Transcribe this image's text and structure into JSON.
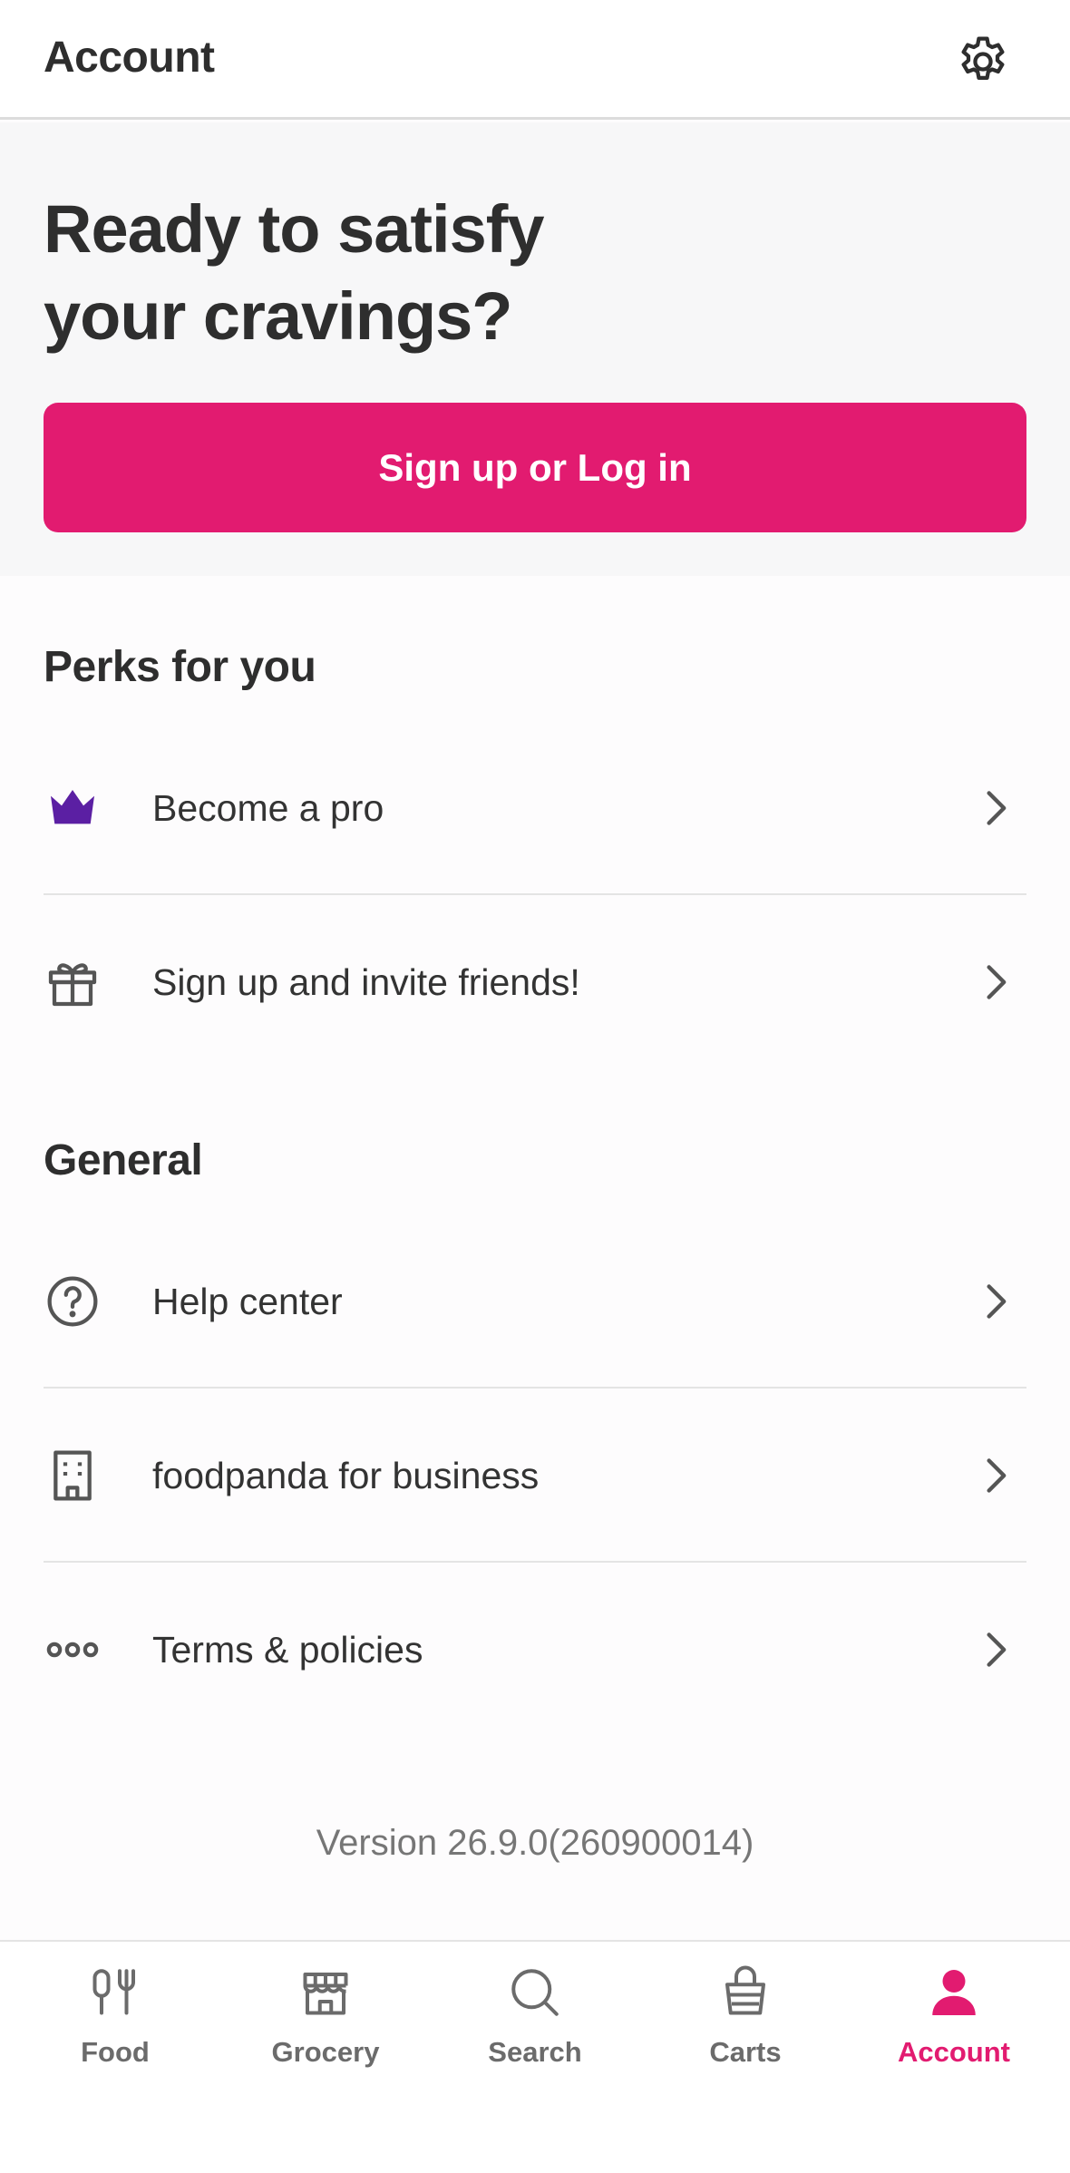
{
  "header": {
    "title": "Account",
    "settings_icon": "gear-icon"
  },
  "hero": {
    "title_line1": "Ready to satisfy",
    "title_line2": "your cravings?",
    "cta_label": "Sign up or Log in"
  },
  "perks": {
    "title": "Perks for you",
    "items": [
      {
        "label": "Become a pro",
        "icon": "crown-icon"
      },
      {
        "label": "Sign up and invite friends!",
        "icon": "gift-icon"
      }
    ]
  },
  "general": {
    "title": "General",
    "items": [
      {
        "label": "Help center",
        "icon": "question-circle-icon"
      },
      {
        "label": "foodpanda for business",
        "icon": "building-icon"
      },
      {
        "label": "Terms & policies",
        "icon": "more-dots-icon"
      }
    ]
  },
  "version": "Version 26.9.0(260900014)",
  "bottom_nav": {
    "items": [
      {
        "label": "Food",
        "icon": "fork-knife-icon",
        "active": false
      },
      {
        "label": "Grocery",
        "icon": "store-icon",
        "active": false
      },
      {
        "label": "Search",
        "icon": "search-icon",
        "active": false
      },
      {
        "label": "Carts",
        "icon": "basket-icon",
        "active": false
      },
      {
        "label": "Account",
        "icon": "person-icon",
        "active": true
      }
    ]
  },
  "colors": {
    "brand": "#e21b70",
    "crown": "#5b1fa3",
    "text": "#333333",
    "muted": "#6b6b6b"
  }
}
